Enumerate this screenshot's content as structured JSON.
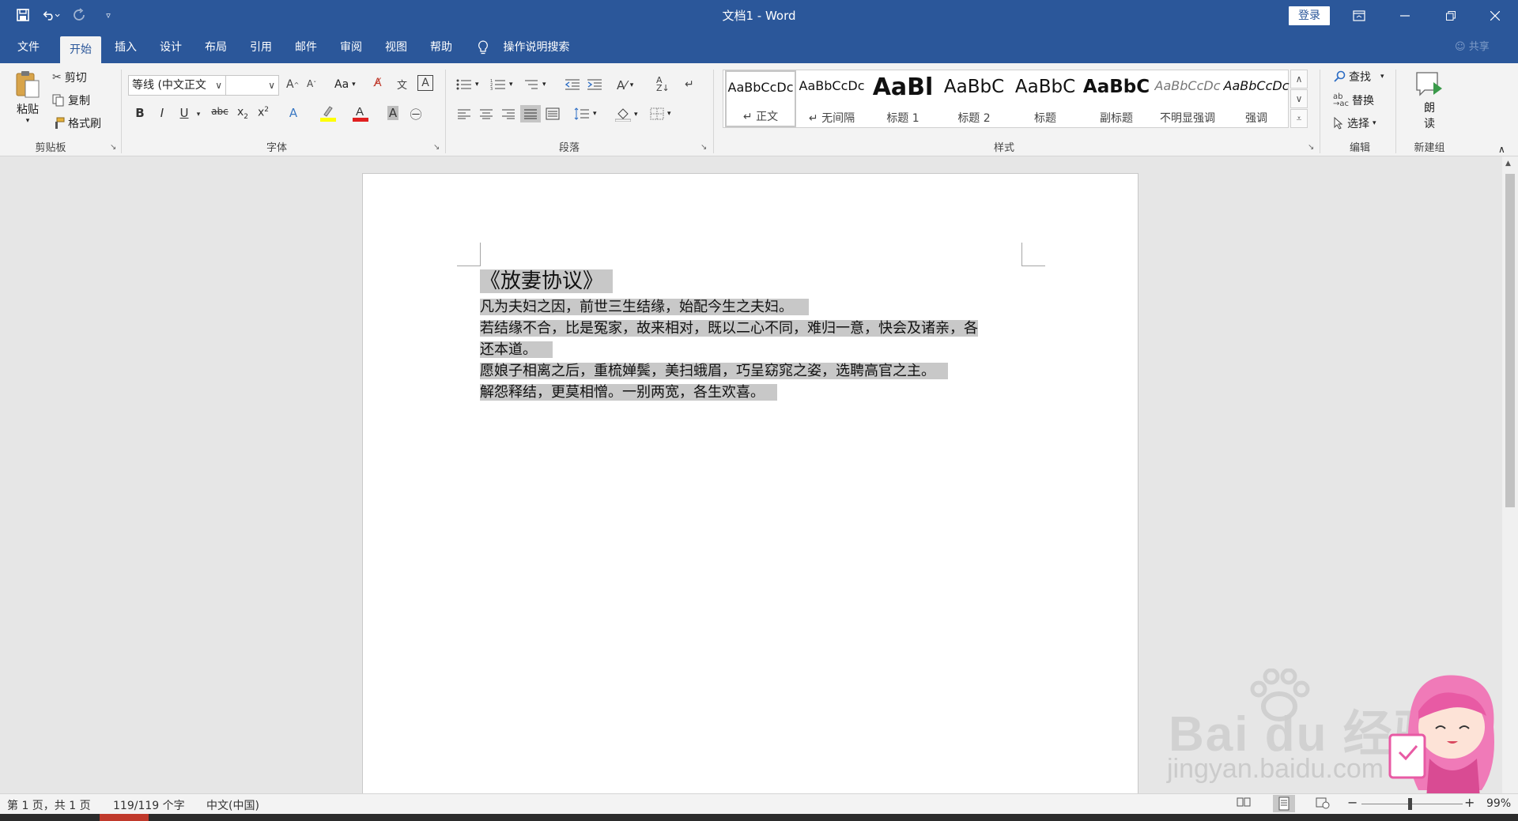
{
  "window": {
    "title": "文档1  -  Word",
    "login_label": "登录"
  },
  "qat": {
    "save_icon": "save-icon",
    "undo_icon": "undo-icon",
    "redo_icon": "redo-icon",
    "customize_icon": "customize-qat-icon"
  },
  "tabs": {
    "file": "文件",
    "home": "开始",
    "insert": "插入",
    "design": "设计",
    "layout": "布局",
    "references": "引用",
    "mailings": "邮件",
    "review": "审阅",
    "view": "视图",
    "help": "帮助",
    "tell_me": "操作说明搜索",
    "share": "共享"
  },
  "clipboard": {
    "paste": "粘贴",
    "cut": "剪切",
    "copy": "复制",
    "format_painter": "格式刷",
    "label": "剪贴板"
  },
  "font": {
    "font_name": "等线 (中文正文",
    "font_size": "",
    "change_case": "Aa",
    "label": "字体"
  },
  "paragraph": {
    "label": "段落"
  },
  "styles": {
    "label": "样式",
    "items": [
      {
        "sample": "AaBbCcDc",
        "name": "↵ 正文"
      },
      {
        "sample": "AaBbCcDc",
        "name": "↵ 无间隔"
      },
      {
        "sample": "AaBl",
        "name": "标题 1"
      },
      {
        "sample": "AaBbC",
        "name": "标题 2"
      },
      {
        "sample": "AaBbC",
        "name": "标题"
      },
      {
        "sample": "AaBbC",
        "name": "副标题"
      },
      {
        "sample": "AaBbCcDc",
        "name": "不明显强调"
      },
      {
        "sample": "AaBbCcDc",
        "name": "强调"
      }
    ]
  },
  "editing": {
    "find": "查找",
    "replace": "替换",
    "select": "选择",
    "label": "编辑"
  },
  "new_group": {
    "read_aloud_1": "朗",
    "read_aloud_2": "读",
    "label": "新建组"
  },
  "document": {
    "title": "《放妻协议》",
    "lines": [
      "凡为夫妇之因，前世三生结缘，始配今生之夫妇。",
      "若结缘不合，比是冤家，故来相对，既以二心不同，难归一意，快会及诸亲，各",
      "还本道。",
      "愿娘子相离之后，重梳婵鬓，美扫蛾眉，巧呈窈窕之姿，选聘高官之主。",
      "解怨释结，更莫相憎。一别两宽，各生欢喜。"
    ]
  },
  "status": {
    "page": "第 1 页，共 1 页",
    "words": "119/119 个字",
    "language": "中文(中国)",
    "zoom": "99%"
  },
  "watermark": {
    "brand": "Bai du 经验",
    "url": "jingyan.baidu.com"
  }
}
